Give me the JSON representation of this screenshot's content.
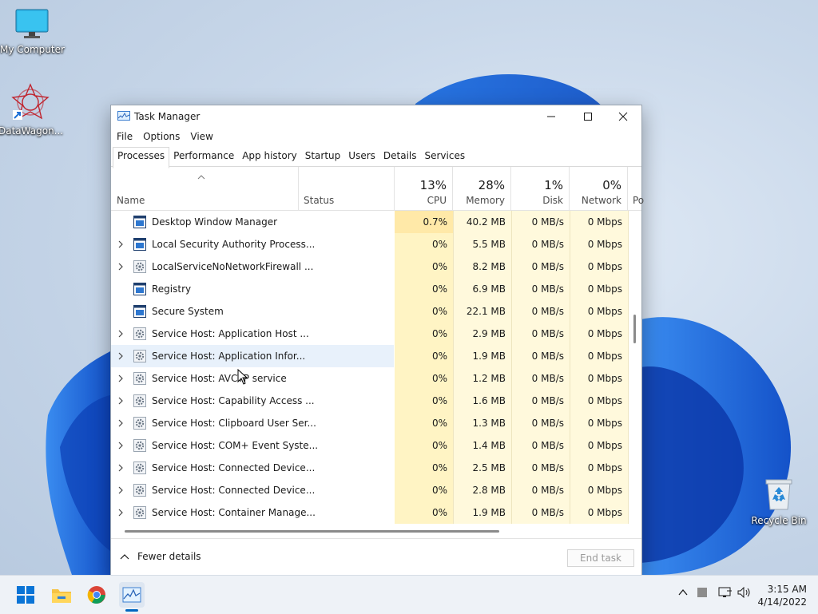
{
  "desktop": {
    "icons": [
      {
        "label": "My Computer"
      },
      {
        "label": "DataWagon..."
      },
      {
        "label": "Recycle Bin"
      }
    ]
  },
  "window": {
    "title": "Task Manager",
    "menu": [
      "File",
      "Options",
      "View"
    ],
    "tabs": [
      "Processes",
      "Performance",
      "App history",
      "Startup",
      "Users",
      "Details",
      "Services"
    ],
    "active_tab": "Processes",
    "columns": {
      "name": "Name",
      "status": "Status",
      "cpu": {
        "label": "CPU",
        "total": "13%"
      },
      "memory": {
        "label": "Memory",
        "total": "28%"
      },
      "disk": {
        "label": "Disk",
        "total": "1%"
      },
      "network": {
        "label": "Network",
        "total": "0%"
      },
      "power": {
        "label": "Po"
      }
    },
    "processes": [
      {
        "name": "Desktop Window Manager",
        "expandable": false,
        "icon": "window-app-icon",
        "cpu": "0.7%",
        "memory": "40.2 MB",
        "disk": "0 MB/s",
        "network": "0 Mbps"
      },
      {
        "name": "Local Security Authority Process...",
        "expandable": true,
        "icon": "window-app-icon",
        "cpu": "0%",
        "memory": "5.5 MB",
        "disk": "0 MB/s",
        "network": "0 Mbps"
      },
      {
        "name": "LocalServiceNoNetworkFirewall ...",
        "expandable": true,
        "icon": "gear-icon",
        "cpu": "0%",
        "memory": "8.2 MB",
        "disk": "0 MB/s",
        "network": "0 Mbps"
      },
      {
        "name": "Registry",
        "expandable": false,
        "icon": "window-app-icon",
        "cpu": "0%",
        "memory": "6.9 MB",
        "disk": "0 MB/s",
        "network": "0 Mbps"
      },
      {
        "name": "Secure System",
        "expandable": false,
        "icon": "window-app-icon",
        "cpu": "0%",
        "memory": "22.1 MB",
        "disk": "0 MB/s",
        "network": "0 Mbps"
      },
      {
        "name": "Service Host: Application Host ...",
        "expandable": true,
        "icon": "gear-icon",
        "cpu": "0%",
        "memory": "2.9 MB",
        "disk": "0 MB/s",
        "network": "0 Mbps"
      },
      {
        "name": "Service Host: Application Infor...",
        "expandable": true,
        "icon": "gear-icon",
        "cpu": "0%",
        "memory": "1.9 MB",
        "disk": "0 MB/s",
        "network": "0 Mbps",
        "hover": true
      },
      {
        "name": "Service Host: AVCTP service",
        "expandable": true,
        "icon": "gear-icon",
        "cpu": "0%",
        "memory": "1.2 MB",
        "disk": "0 MB/s",
        "network": "0 Mbps"
      },
      {
        "name": "Service Host: Capability Access ...",
        "expandable": true,
        "icon": "gear-icon",
        "cpu": "0%",
        "memory": "1.6 MB",
        "disk": "0 MB/s",
        "network": "0 Mbps"
      },
      {
        "name": "Service Host: Clipboard User Ser...",
        "expandable": true,
        "icon": "gear-icon",
        "cpu": "0%",
        "memory": "1.3 MB",
        "disk": "0 MB/s",
        "network": "0 Mbps"
      },
      {
        "name": "Service Host: COM+ Event Syste...",
        "expandable": true,
        "icon": "gear-icon",
        "cpu": "0%",
        "memory": "1.4 MB",
        "disk": "0 MB/s",
        "network": "0 Mbps"
      },
      {
        "name": "Service Host: Connected Device...",
        "expandable": true,
        "icon": "gear-icon",
        "cpu": "0%",
        "memory": "2.5 MB",
        "disk": "0 MB/s",
        "network": "0 Mbps"
      },
      {
        "name": "Service Host: Connected Device...",
        "expandable": true,
        "icon": "gear-icon",
        "cpu": "0%",
        "memory": "2.8 MB",
        "disk": "0 MB/s",
        "network": "0 Mbps"
      },
      {
        "name": "Service Host: Container Manage...",
        "expandable": true,
        "icon": "gear-icon",
        "cpu": "0%",
        "memory": "1.9 MB",
        "disk": "0 MB/s",
        "network": "0 Mbps"
      }
    ],
    "footer": {
      "fewer_details": "Fewer details",
      "end_task": "End task"
    }
  },
  "taskbar": {
    "apps": [
      "start-icon",
      "file-explorer-icon",
      "chrome-icon",
      "task-manager-icon"
    ],
    "clock": {
      "time": "3:15 AM",
      "date": "4/14/2022"
    }
  },
  "colors": {
    "accent": "#0067c0",
    "cpu_column": "#fff4c4",
    "cpu_column_hot": "#ffe9a8",
    "column_bg": "#fff9dc"
  }
}
